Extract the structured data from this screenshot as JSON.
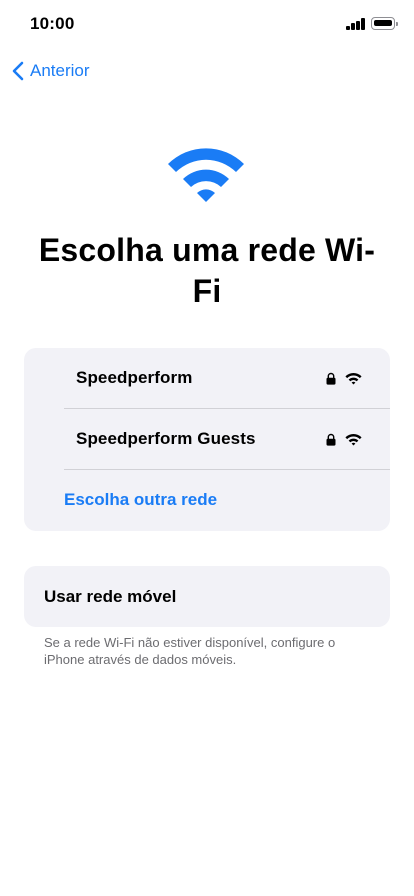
{
  "status_bar": {
    "time": "10:00"
  },
  "nav": {
    "back_label": "Anterior"
  },
  "title": "Escolha uma rede Wi-Fi",
  "networks": [
    {
      "name": "Speedperform",
      "secured": true,
      "signal": "full"
    },
    {
      "name": "Speedperform Guests",
      "secured": true,
      "signal": "full"
    }
  ],
  "other_network_label": "Escolha outra rede",
  "cellular": {
    "label": "Usar rede móvel",
    "footnote": "Se a rede Wi-Fi não estiver disponível, configure o iPhone através de dados móveis."
  },
  "icons": {
    "hero": "wifi-icon",
    "back": "chevron-left-icon",
    "lock": "lock-icon",
    "signal": "wifi-icon"
  },
  "colors": {
    "accent": "#1a7cf5",
    "card_background": "#f2f2f7",
    "footnote_text": "#6c6c70"
  }
}
